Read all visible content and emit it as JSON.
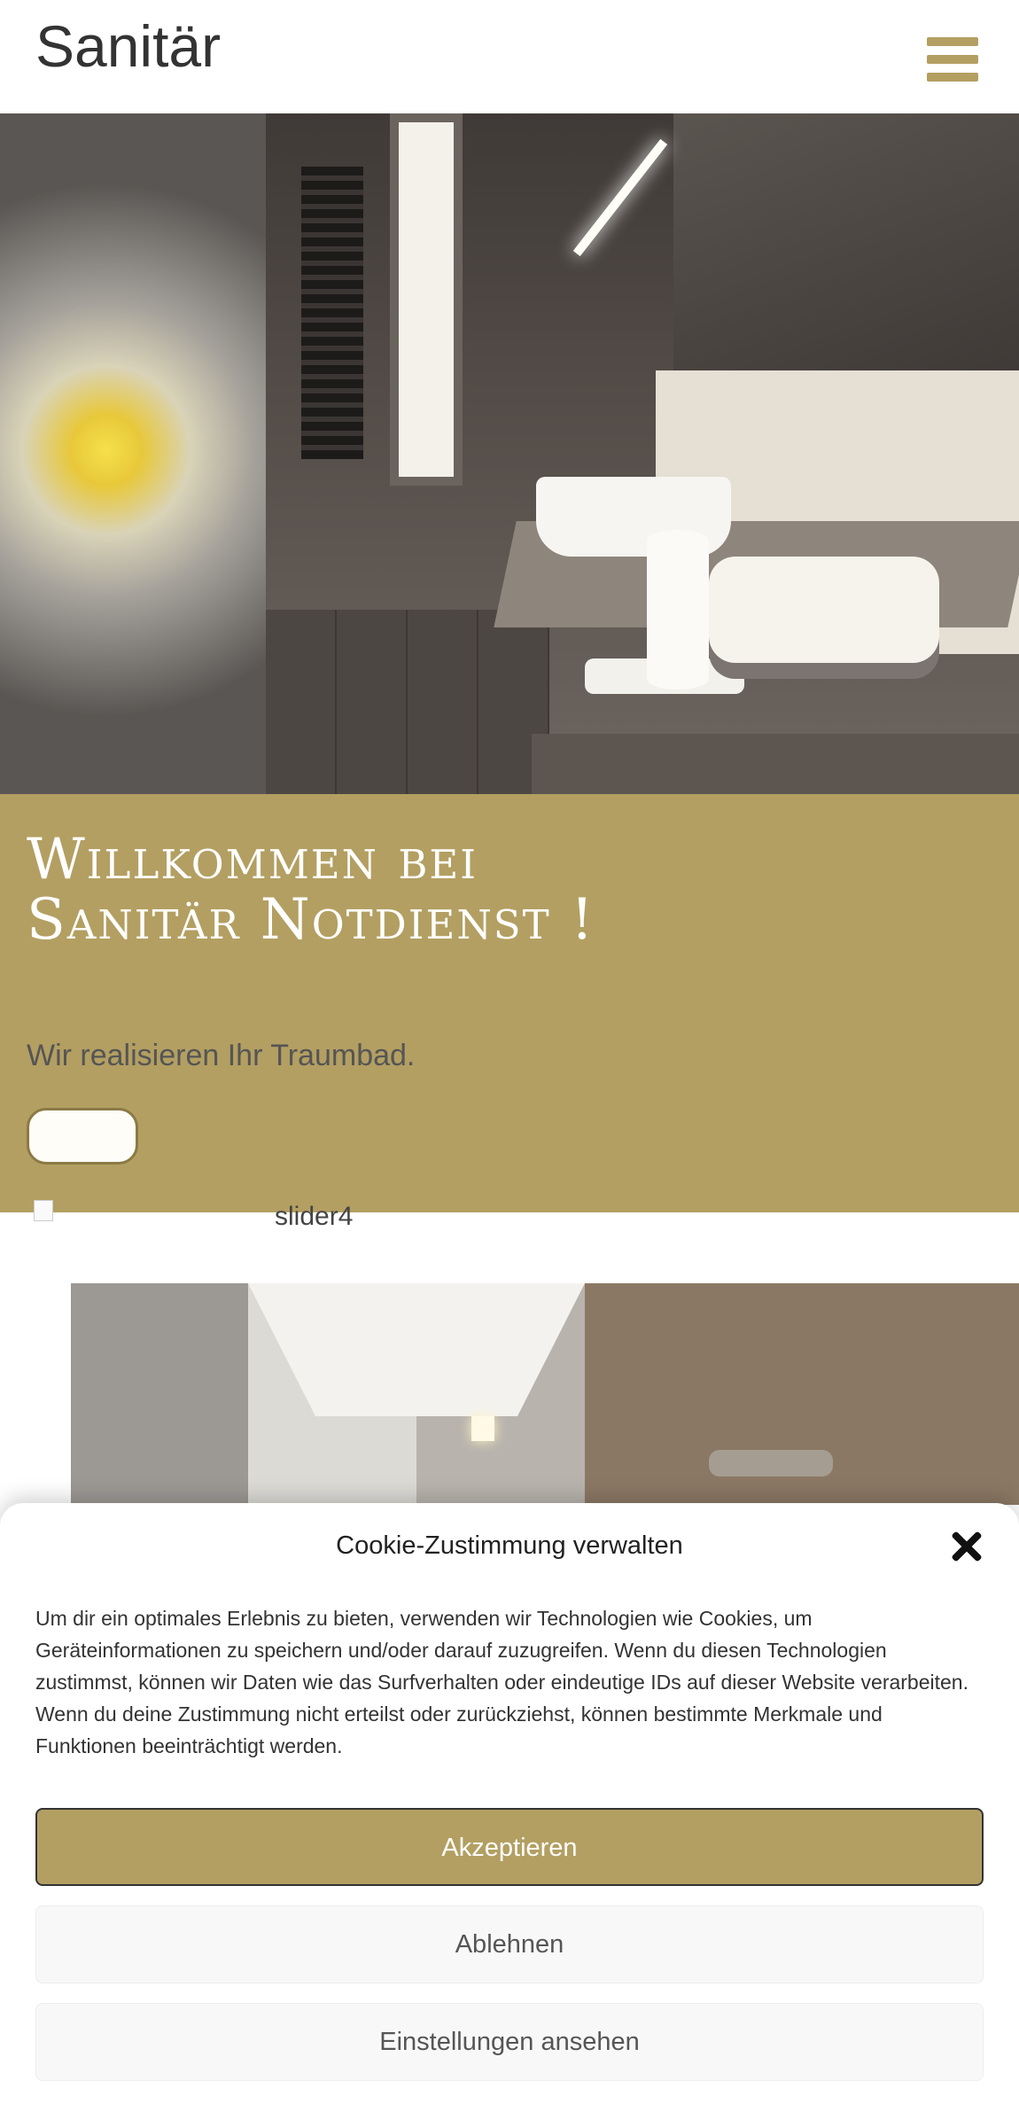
{
  "header": {
    "site_title": "Sanitär",
    "menu_icon": "hamburger-menu-icon"
  },
  "hero": {
    "title": "Willkommen bei Sanitär Notdienst !",
    "subtitle": "Wir realisieren Ihr Traumbad.",
    "button_label": ""
  },
  "slider": {
    "alt_text": "slider4"
  },
  "cookie": {
    "title": "Cookie-Zustimmung verwalten",
    "text": "Um dir ein optimales Erlebnis zu bieten, verwenden wir Technologien wie Cookies, um Geräteinformationen zu speichern und/oder darauf zuzugreifen. Wenn du diesen Technologien zustimmst, können wir Daten wie das Surfverhalten oder eindeutige IDs auf dieser Website verarbeiten. Wenn du deine Zustimmung nicht erteilst oder zurückziehst, können bestimmte Merkmale und Funktionen beeinträchtigt werden.",
    "accept_label": "Akzeptieren",
    "deny_label": "Ablehnen",
    "preferences_label": "Einstellungen ansehen",
    "close_icon": "close-icon"
  },
  "colors": {
    "accent": "#b39f62",
    "text_dark": "#333333"
  }
}
